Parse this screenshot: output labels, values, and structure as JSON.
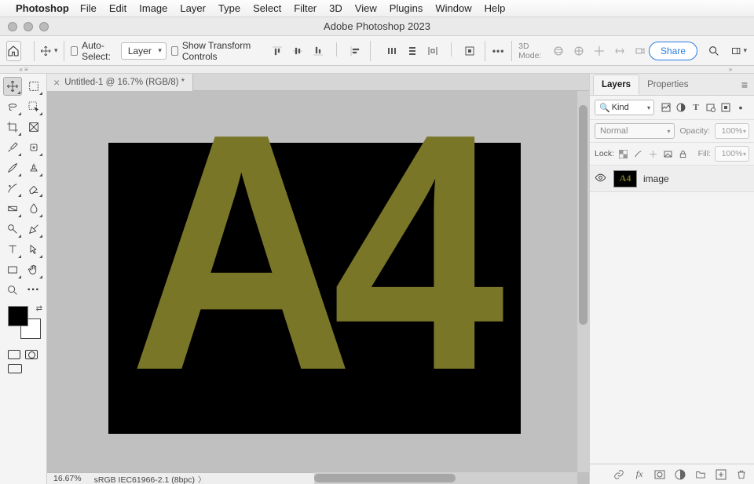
{
  "mac_menu": {
    "app_name": "Photoshop",
    "items": [
      "File",
      "Edit",
      "Image",
      "Layer",
      "Type",
      "Select",
      "Filter",
      "3D",
      "View",
      "Plugins",
      "Window",
      "Help"
    ]
  },
  "window": {
    "title": "Adobe Photoshop 2023"
  },
  "options_bar": {
    "auto_select_label": "Auto-Select:",
    "auto_select_target": "Layer",
    "show_transform_label": "Show Transform Controls",
    "three_d_label": "3D Mode:",
    "share_label": "Share"
  },
  "document_tab": {
    "title": "Untitled-1 @ 16.7% (RGB/8) *"
  },
  "canvas": {
    "text_content": "A4",
    "bg_color": "#000000",
    "text_color": "#7a7628"
  },
  "status": {
    "zoom": "16.67%",
    "profile": "sRGB IEC61966-2.1 (8bpc)"
  },
  "layers_panel": {
    "tabs": {
      "layers": "Layers",
      "properties": "Properties"
    },
    "kind_label": "Kind",
    "blend_mode": "Normal",
    "opacity_label": "Opacity:",
    "opacity_value": "100%",
    "lock_label": "Lock:",
    "fill_label": "Fill:",
    "fill_value": "100%",
    "layers": [
      {
        "name": "image",
        "thumb_text": "A4",
        "visible": true
      }
    ]
  }
}
